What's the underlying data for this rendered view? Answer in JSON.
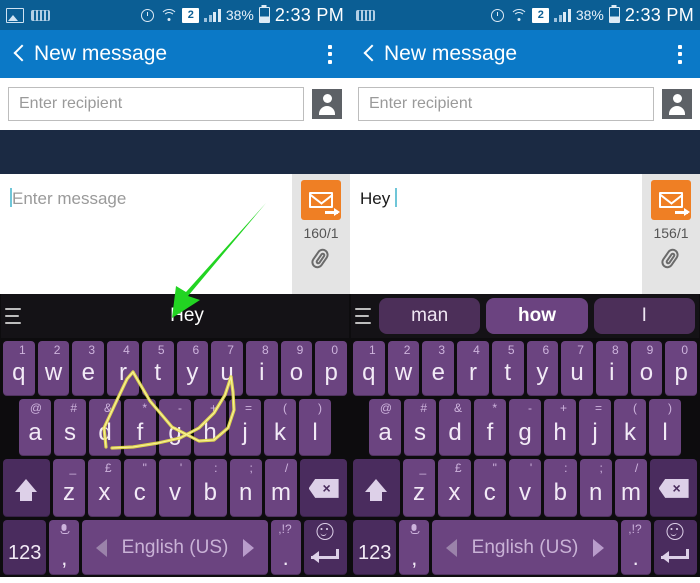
{
  "status_bar": {
    "icons_left": [
      "image-icon",
      "keyboard-icon"
    ],
    "icons_right": [
      "alarm-icon",
      "wifi-icon",
      "sim-badge",
      "signal-icon",
      "battery-icon"
    ],
    "sim_badge": "2",
    "battery_percent": "38%",
    "time": "2:33 PM"
  },
  "app_bar": {
    "back_icon": "back-chevron-icon",
    "title": "New message",
    "overflow_icon": "overflow-menu-icon"
  },
  "recipient": {
    "placeholder": "Enter recipient",
    "value": "",
    "contact_icon": "contact-picker-icon"
  },
  "left_panel": {
    "compose": {
      "placeholder": "Enter message",
      "value": "",
      "char_count": "160/1",
      "send_icon": "send-mms-icon",
      "attach_icon": "paperclip-icon"
    },
    "suggestion_bar": {
      "menu_icon": "keyboard-menu-icon",
      "suggestions": [
        "Hey"
      ],
      "active_index": -1
    },
    "annotation": {
      "arrow_color": "#22d422",
      "swipe_trail_color": "#e8e04a"
    }
  },
  "right_panel": {
    "compose": {
      "placeholder": "Enter message",
      "value": "Hey ",
      "char_count": "156/1",
      "send_icon": "send-mms-icon",
      "attach_icon": "paperclip-icon"
    },
    "suggestion_bar": {
      "menu_icon": "keyboard-menu-icon",
      "suggestions": [
        "man",
        "how",
        "I"
      ],
      "active_index": 1
    }
  },
  "keyboard": {
    "row1": [
      {
        "main": "q",
        "hint": "1"
      },
      {
        "main": "w",
        "hint": "2"
      },
      {
        "main": "e",
        "hint": "3"
      },
      {
        "main": "r",
        "hint": "4"
      },
      {
        "main": "t",
        "hint": "5"
      },
      {
        "main": "y",
        "hint": "6"
      },
      {
        "main": "u",
        "hint": "7"
      },
      {
        "main": "i",
        "hint": "8"
      },
      {
        "main": "o",
        "hint": "9"
      },
      {
        "main": "p",
        "hint": "0"
      }
    ],
    "row2": [
      {
        "main": "a",
        "hint": "@"
      },
      {
        "main": "s",
        "hint": "#"
      },
      {
        "main": "d",
        "hint": "&"
      },
      {
        "main": "f",
        "hint": "*"
      },
      {
        "main": "g",
        "hint": "-"
      },
      {
        "main": "h",
        "hint": "+"
      },
      {
        "main": "j",
        "hint": "="
      },
      {
        "main": "k",
        "hint": "("
      },
      {
        "main": "l",
        "hint": ")"
      }
    ],
    "row3": [
      {
        "main": "z",
        "hint": "_"
      },
      {
        "main": "x",
        "hint": "£"
      },
      {
        "main": "c",
        "hint": "\""
      },
      {
        "main": "v",
        "hint": "'"
      },
      {
        "main": "b",
        "hint": ":"
      },
      {
        "main": "n",
        "hint": ";"
      },
      {
        "main": "m",
        "hint": "/"
      }
    ],
    "shift_label": "shift-key",
    "backspace_label": "×",
    "numeric_label": "123",
    "comma_label": ",",
    "comma_hint": "mic-icon",
    "space_label": "English (US)",
    "period_label": ".",
    "period_hint": ",!?",
    "enter_hint": "smiley-icon"
  }
}
